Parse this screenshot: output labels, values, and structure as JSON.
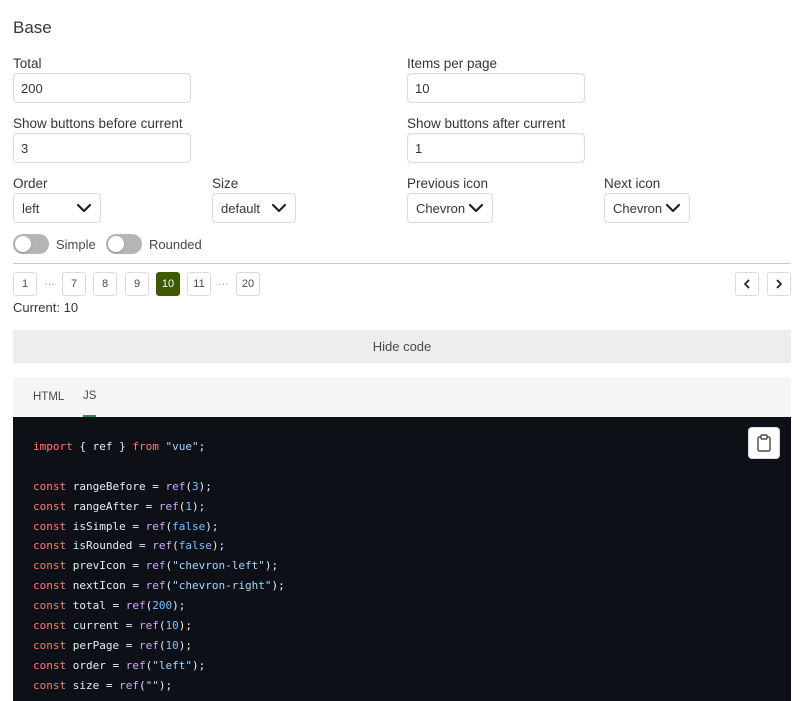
{
  "section_title": "Base",
  "fields": {
    "total": {
      "label": "Total",
      "value": "200"
    },
    "items_per_page": {
      "label": "Items per page",
      "value": "10"
    },
    "buttons_before": {
      "label": "Show buttons before current",
      "value": "3"
    },
    "buttons_after": {
      "label": "Show buttons after current",
      "value": "1"
    }
  },
  "selects": {
    "order": {
      "label": "Order",
      "value": "left"
    },
    "size": {
      "label": "Size",
      "value": "default"
    },
    "previous_icon": {
      "label": "Previous icon",
      "value": "Chevron"
    },
    "next_icon": {
      "label": "Next icon",
      "value": "Chevron"
    }
  },
  "switches": {
    "simple": {
      "label": "Simple",
      "on": false
    },
    "rounded": {
      "label": "Rounded",
      "on": false
    }
  },
  "pagination": {
    "pages": [
      "1",
      "7",
      "8",
      "9",
      "10",
      "11",
      "20"
    ],
    "ellipsis": "…",
    "active_page": "10",
    "prev_icon": "chevron-left-icon",
    "next_icon": "chevron-right-icon",
    "current_label": "Current:",
    "current_value": "10"
  },
  "hide_code_label": "Hide code",
  "tabs": [
    {
      "label": "HTML",
      "active": false
    },
    {
      "label": "JS",
      "active": true
    }
  ],
  "code_lines": [
    "import { ref } from \"vue\";",
    "",
    "const rangeBefore = ref(3);",
    "const rangeAfter = ref(1);",
    "const isSimple = ref(false);",
    "const isRounded = ref(false);",
    "const prevIcon = ref(\"chevron-left\");",
    "const nextIcon = ref(\"chevron-right\");",
    "const total = ref(200);",
    "const current = ref(10);",
    "const perPage = ref(10);",
    "const order = ref(\"left\");",
    "const size = ref(\"\");"
  ],
  "copy_icon": "clipboard-icon",
  "colors": {
    "active_page": "#3d5a00",
    "code_background": "#0d1117",
    "tab_underline": "#2d8a5a"
  }
}
